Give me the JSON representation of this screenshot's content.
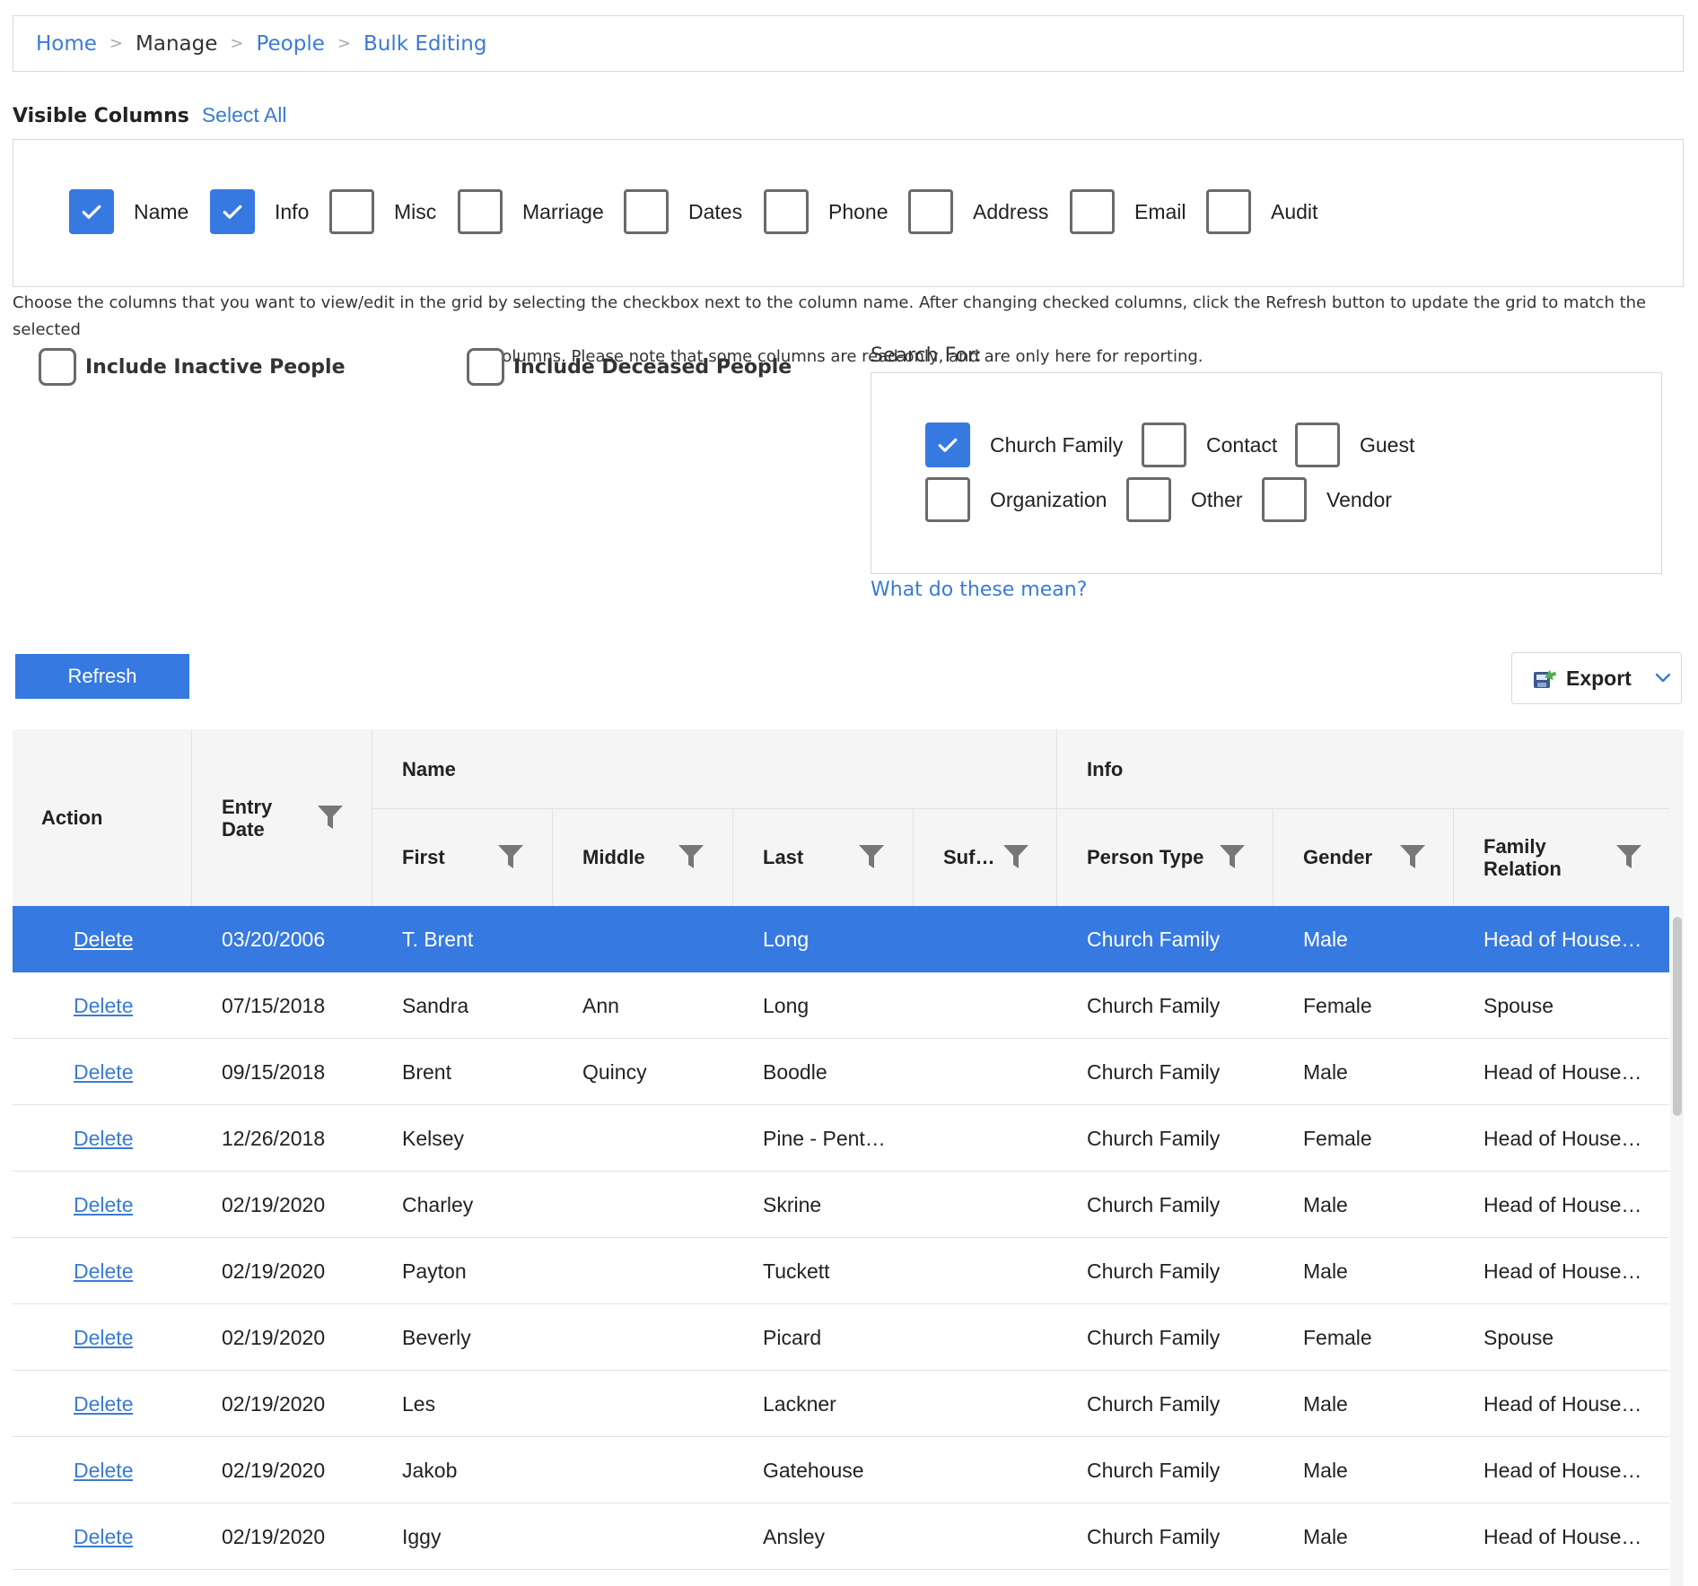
{
  "breadcrumb": {
    "home": "Home",
    "manage": "Manage",
    "people": "People",
    "bulk": "Bulk Editing",
    "sep": ">"
  },
  "visible_columns": {
    "title": "Visible Columns",
    "select_all": "Select All",
    "options": [
      {
        "label": "Name",
        "checked": true
      },
      {
        "label": "Info",
        "checked": true
      },
      {
        "label": "Misc",
        "checked": false
      },
      {
        "label": "Marriage",
        "checked": false
      },
      {
        "label": "Dates",
        "checked": false
      },
      {
        "label": "Phone",
        "checked": false
      },
      {
        "label": "Address",
        "checked": false
      },
      {
        "label": "Email",
        "checked": false
      },
      {
        "label": "Audit",
        "checked": false
      }
    ],
    "help_line1": "Choose the columns that you want to view/edit in the grid by selecting the checkbox next to the column name. After changing checked columns, click the Refresh button to update the grid to match the selected",
    "help_line2": "columns. Please note that some columns are read-only, and are only here for reporting."
  },
  "include": {
    "inactive": "Include Inactive People",
    "deceased": "Include Deceased People"
  },
  "search": {
    "label": "Search For:",
    "options": [
      {
        "label": "Church Family",
        "checked": true
      },
      {
        "label": "Contact",
        "checked": false
      },
      {
        "label": "Guest",
        "checked": false
      },
      {
        "label": "Organization",
        "checked": false
      },
      {
        "label": "Other",
        "checked": false
      },
      {
        "label": "Vendor",
        "checked": false
      }
    ],
    "what_link": "What do these mean?"
  },
  "toolbar": {
    "refresh": "Refresh",
    "export": "Export"
  },
  "grid": {
    "headers": {
      "action": "Action",
      "entry_date_1": "Entry",
      "entry_date_2": "Date",
      "name_group": "Name",
      "info_group": "Info",
      "first": "First",
      "middle": "Middle",
      "last": "Last",
      "suffix": "Suf…",
      "person_type": "Person Type",
      "gender": "Gender",
      "family_relation_1": "Family",
      "family_relation_2": "Relation"
    },
    "rows": [
      {
        "action": "Delete",
        "date": "03/20/2006",
        "first": "T. Brent",
        "middle": "",
        "last": "Long",
        "suffix": "",
        "type": "Church Family",
        "gender": "Male",
        "relation": "Head of House…"
      },
      {
        "action": "Delete",
        "date": "07/15/2018",
        "first": "Sandra",
        "middle": "Ann",
        "last": "Long",
        "suffix": "",
        "type": "Church Family",
        "gender": "Female",
        "relation": "Spouse"
      },
      {
        "action": "Delete",
        "date": "09/15/2018",
        "first": "Brent",
        "middle": "Quincy",
        "last": "Boodle",
        "suffix": "",
        "type": "Church Family",
        "gender": "Male",
        "relation": "Head of House…"
      },
      {
        "action": "Delete",
        "date": "12/26/2018",
        "first": "Kelsey",
        "middle": "",
        "last": "Pine - Pent…",
        "suffix": "",
        "type": "Church Family",
        "gender": "Female",
        "relation": "Head of House…"
      },
      {
        "action": "Delete",
        "date": "02/19/2020",
        "first": "Charley",
        "middle": "",
        "last": "Skrine",
        "suffix": "",
        "type": "Church Family",
        "gender": "Male",
        "relation": "Head of House…"
      },
      {
        "action": "Delete",
        "date": "02/19/2020",
        "first": "Payton",
        "middle": "",
        "last": "Tuckett",
        "suffix": "",
        "type": "Church Family",
        "gender": "Male",
        "relation": "Head of House…"
      },
      {
        "action": "Delete",
        "date": "02/19/2020",
        "first": "Beverly",
        "middle": "",
        "last": "Picard",
        "suffix": "",
        "type": "Church Family",
        "gender": "Female",
        "relation": "Spouse"
      },
      {
        "action": "Delete",
        "date": "02/19/2020",
        "first": "Les",
        "middle": "",
        "last": "Lackner",
        "suffix": "",
        "type": "Church Family",
        "gender": "Male",
        "relation": "Head of House…"
      },
      {
        "action": "Delete",
        "date": "02/19/2020",
        "first": "Jakob",
        "middle": "",
        "last": "Gatehouse",
        "suffix": "",
        "type": "Church Family",
        "gender": "Male",
        "relation": "Head of House…"
      },
      {
        "action": "Delete",
        "date": "02/19/2020",
        "first": "Iggy",
        "middle": "",
        "last": "Ansley",
        "suffix": "",
        "type": "Church Family",
        "gender": "Male",
        "relation": "Head of House…"
      }
    ],
    "selected_row": 0
  },
  "colors": {
    "accent": "#3679e0",
    "link": "#3a7bd5",
    "header_bg": "#f5f5f5",
    "border": "#d8d8d8"
  },
  "icons": {
    "check": "check-icon",
    "filter": "filter-icon",
    "export": "export-icon",
    "chevron": "chevron-down-icon"
  }
}
